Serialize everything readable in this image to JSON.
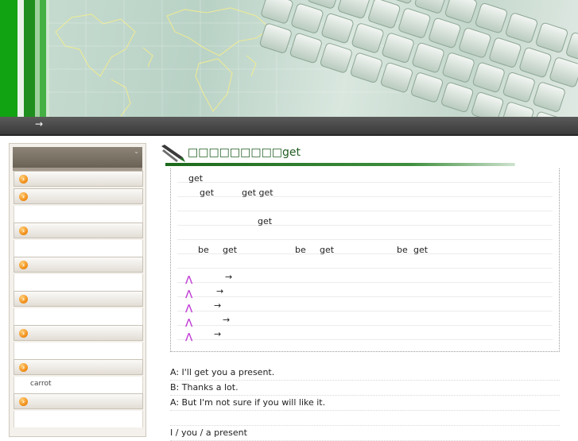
{
  "nav": {
    "arrow": "→"
  },
  "sidebar": {
    "items": [
      {
        "icon": "orange-arrow-icon",
        "label": ""
      },
      {
        "icon": "orange-arrow-icon",
        "label": ""
      },
      {
        "icon": "orange-arrow-icon",
        "label": ""
      },
      {
        "icon": "orange-arrow-icon",
        "label": ""
      },
      {
        "icon": "orange-arrow-icon",
        "label": ""
      },
      {
        "icon": "orange-arrow-icon",
        "label": ""
      },
      {
        "icon": "orange-arrow-icon",
        "label": ""
      },
      {
        "icon": "orange-arrow-icon",
        "label": ""
      }
    ],
    "carrot_text": "carrot"
  },
  "article": {
    "title": "□□□□□□□□□get",
    "lines": [
      {
        "a": "get"
      },
      {
        "a": "get",
        "b": "get get"
      },
      {
        "a": ""
      },
      {
        "a": "get"
      },
      {
        "a": ""
      },
      {
        "a": "be",
        "b": "get",
        "c": "be",
        "d": "get",
        "e": "be",
        "f": "get"
      }
    ],
    "arrow_rows": [
      "→",
      "→",
      "→",
      "→",
      "→"
    ],
    "triangle_icon": "purple-triangle-icon"
  },
  "dialog": {
    "line1": "A: I'll get you a present.",
    "line2": "B: Thanks a lot.",
    "line3": "A: But I'm not sure if you will like it.",
    "line4": "I / you / a present"
  },
  "colors": {
    "title_green": "#1f5c1f",
    "stripe_green": "#2aa82a",
    "nav_dark": "#3a3a3a",
    "triangle_purple": "#c23fd6",
    "sidebar_orb": "#f08a12"
  }
}
